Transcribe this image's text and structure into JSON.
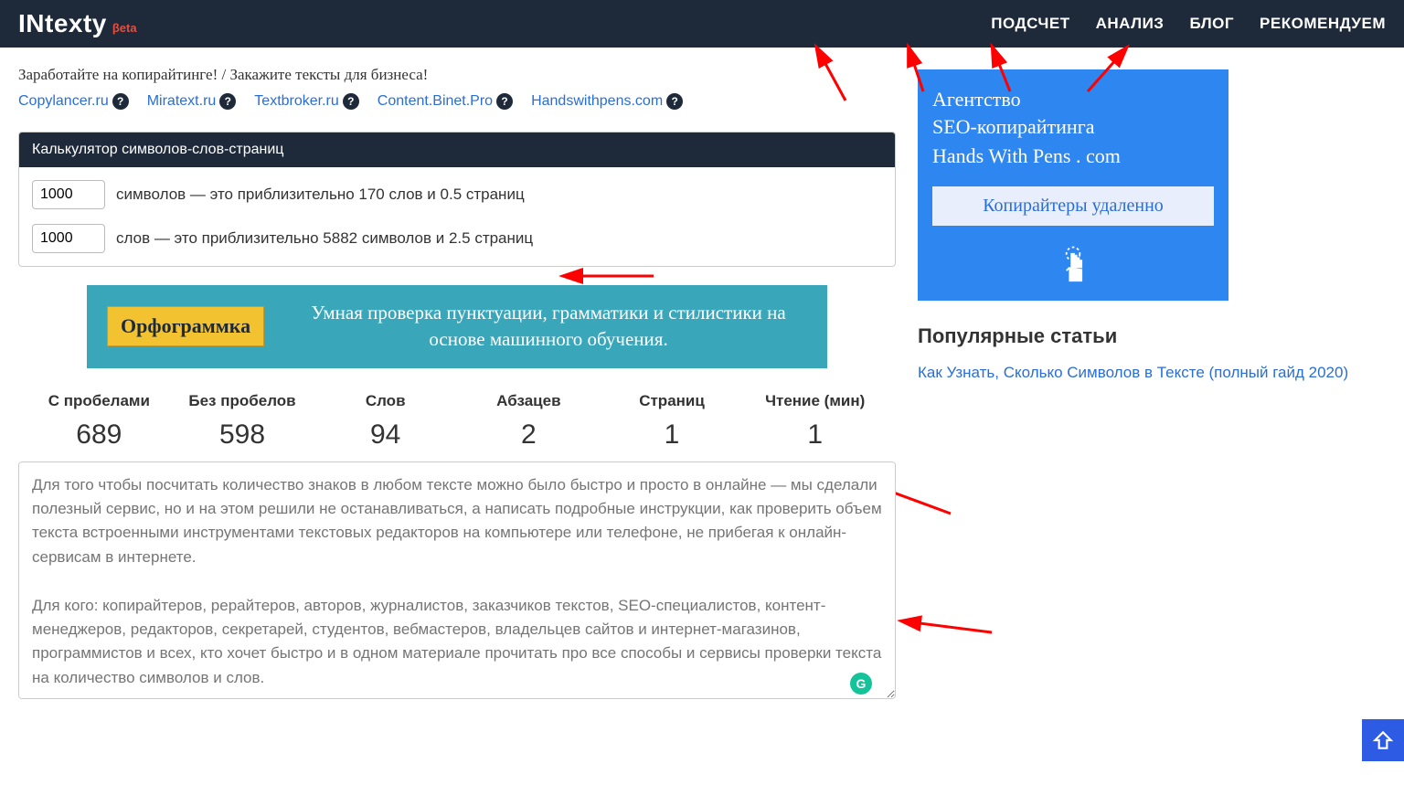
{
  "header": {
    "logo": "INtexty",
    "beta": "βeta",
    "nav": [
      "ПОДСЧЕТ",
      "АНАЛИЗ",
      "БЛОГ",
      "РЕКОМЕНДУЕМ"
    ]
  },
  "tagline": "Заработайте на копирайтинге! / Закажите тексты для бизнеса!",
  "affiliate_links": [
    "Copylancer.ru",
    "Miratext.ru",
    "Textbroker.ru",
    "Content.Binet.Pro",
    "Handswithpens.com"
  ],
  "calc": {
    "title": "Калькулятор символов-слов-страниц",
    "row1": {
      "value": "1000",
      "text": "символов — это приблизительно 170 слов и 0.5 страниц"
    },
    "row2": {
      "value": "1000",
      "text": "слов — это приблизительно 5882 символов и 2.5 страниц"
    }
  },
  "orfo_banner": {
    "chip": "Орфограммка",
    "text": "Умная проверка пунктуации, грамматики и стилистики на основе машинного обучения."
  },
  "stats": [
    {
      "label": "С пробелами",
      "value": "689"
    },
    {
      "label": "Без пробелов",
      "value": "598"
    },
    {
      "label": "Слов",
      "value": "94"
    },
    {
      "label": "Абзацев",
      "value": "2"
    },
    {
      "label": "Страниц",
      "value": "1"
    },
    {
      "label": "Чтение (мин)",
      "value": "1"
    }
  ],
  "textarea_text": "Для того чтобы посчитать количество знаков в любом тексте можно было быстро и просто в онлайне — мы сделали полезный сервис, но и на этом решили не останавливаться, а написать подробные инструкции, как проверить объем текста встроенными инструментами текстовых редакторов на компьютере или телефоне, не прибегая к онлайн-сервисам в интернете.\n\nДля кого: копирайтеров, рерайтеров, авторов, журналистов, заказчиков текстов, SEO-специалистов, контент-менеджеров, редакторов, секретарей, студентов, вебмастеров, владельцев сайтов и интернет-магазинов, программистов и всех, кто хочет быстро и в одном материале прочитать про все способы и сервисы проверки текста на количество символов и слов.",
  "side_banner": {
    "line1": "Агентство",
    "line2": "SEO-копирайтинга",
    "line3": "Hands With Pens . com",
    "button": "Копирайтеры удаленно"
  },
  "popular": {
    "title": "Популярные статьи",
    "link": "Как Узнать, Сколько Символов в Тексте (полный гайд 2020)"
  },
  "grammarly_badge": "G"
}
